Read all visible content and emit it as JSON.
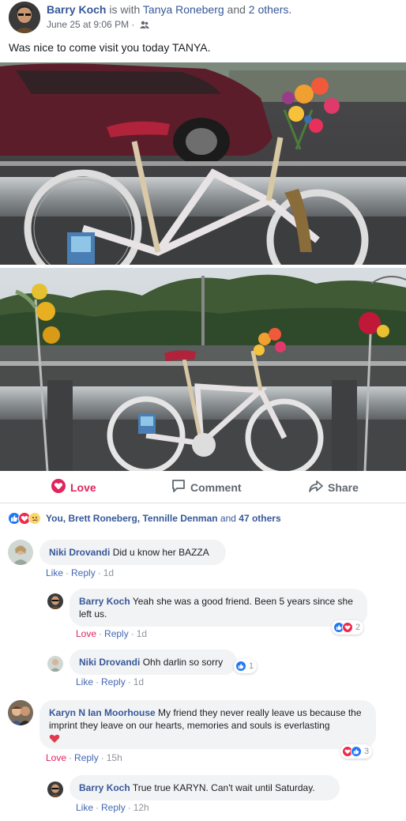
{
  "post": {
    "author": "Barry Koch",
    "with_text": " is with ",
    "tagged": "Tanya Roneberg",
    "and_text": " and ",
    "others": "2 others.",
    "timestamp": "June 25 at 9:06 PM",
    "separator": " · ",
    "audience_icon": "friends-icon",
    "text": "Was nice to come visit you today TANYA."
  },
  "actions": {
    "love_label": "Love",
    "comment_label": "Comment",
    "share_label": "Share"
  },
  "reactions": {
    "icons": [
      "like-icon",
      "love-icon",
      "sad-icon"
    ],
    "names": "You, Brett Roneberg, Tennille Denman",
    "and_text": " and ",
    "others": "47 others"
  },
  "comments": [
    {
      "author": "Niki Drovandi",
      "text": "Did u know her BAZZA",
      "actions": [
        "Like",
        "Reply"
      ],
      "time": "1d"
    },
    {
      "author": "Barry Koch",
      "text": "Yeah she was a good friend. Been 5 years since she left us.",
      "actions": [
        "Love",
        "Reply"
      ],
      "time": "1d",
      "reaction_count": "2"
    },
    {
      "author": "Niki Drovandi",
      "text": "Ohh darlin so sorry",
      "actions": [
        "Like",
        "Reply"
      ],
      "time": "1d",
      "reaction_count": "1"
    },
    {
      "author": "Karyn N Ian Moorhouse",
      "text": "My friend they never really leave us because the imprint they leave on our hearts, memories and souls is everlasting",
      "emoji": "red-heart",
      "actions": [
        "Love",
        "Reply"
      ],
      "time": "15h",
      "reaction_count": "3"
    },
    {
      "author": "Barry Koch",
      "text": "True true KARYN. Can't wait until Saturday.",
      "actions": [
        "Like",
        "Reply"
      ],
      "time": "12h"
    }
  ],
  "colors": {
    "link": "#365899",
    "love": "#e0245e",
    "like": "#2078f4",
    "bubble": "#f2f3f5",
    "muted": "#90949c"
  }
}
